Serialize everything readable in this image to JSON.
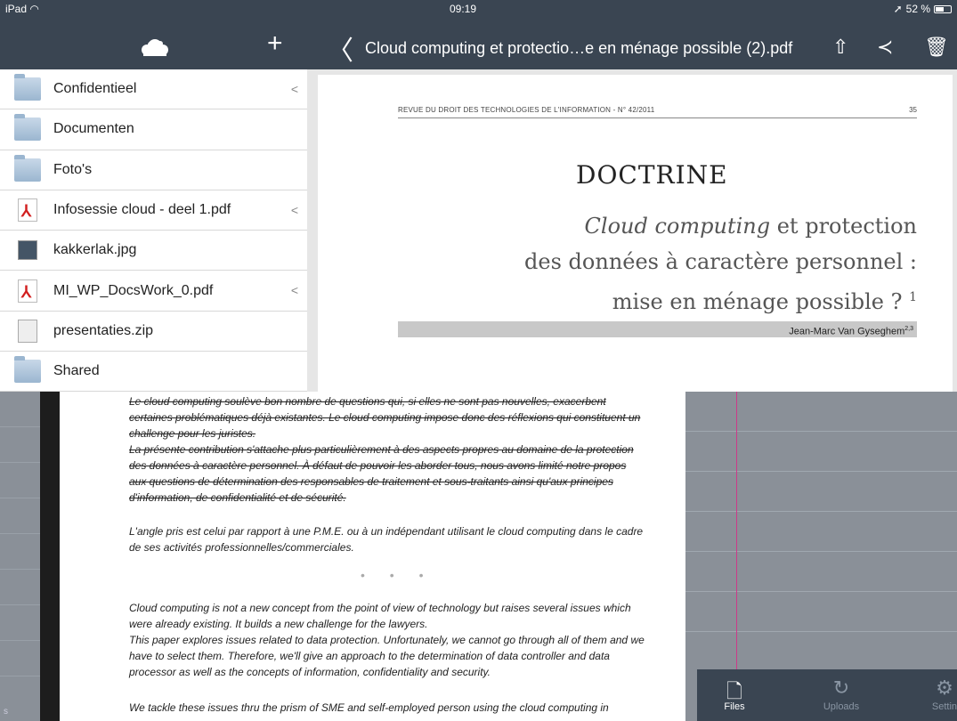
{
  "status": {
    "carrier": "iPad",
    "time": "09:19",
    "battery": "52 %"
  },
  "sidebar": {
    "add_label": "+",
    "files": [
      {
        "name": "Confidentieel",
        "type": "folder",
        "shared": true
      },
      {
        "name": "Documenten",
        "type": "folder",
        "shared": false
      },
      {
        "name": "Foto's",
        "type": "folder",
        "shared": false
      },
      {
        "name": "Infosessie cloud - deel 1.pdf",
        "type": "pdf",
        "shared": true
      },
      {
        "name": "kakkerlak.jpg",
        "type": "image",
        "shared": false
      },
      {
        "name": "MI_WP_DocsWork_0.pdf",
        "type": "pdf",
        "shared": true
      },
      {
        "name": "presentaties.zip",
        "type": "zip",
        "shared": false
      },
      {
        "name": "Shared",
        "type": "folder",
        "shared": false
      }
    ]
  },
  "viewer": {
    "back": "〈",
    "title": "Cloud computing et protectio…e en ménage possible  (2).pdf",
    "journal": "REVUE DU DROIT DES TECHNOLOGIES DE L'INFORMATION - N° 42/2011",
    "page_number": "35",
    "section": "DOCTRINE",
    "title_line1_italic": "Cloud computing",
    "title_line1_rest": " et protection",
    "title_line2": "des données à caractère personnel :",
    "title_line3": "mise en ménage possible ? ",
    "title_sup": "1",
    "author": "Jean-Marc Van Gyseghem",
    "author_sup": "2,3"
  },
  "text_page": {
    "p1": "Le cloud computing soulève bon nombre de questions qui, si elles ne sont pas nouvelles, exacerbent certaines problématiques déjà existantes. Le cloud computing impose donc des réflexions qui constituent un challenge pour les juristes.",
    "p2": "La présente contribution s'attache plus particulièrement à des aspects propres au domaine de la protection des données à caractère personnel. À défaut de pouvoir les aborder tous, nous avons limité notre propos aux questions de détermination des responsables de traitement et sous-traitants ainsi qu'aux principes d'information, de confidentialité et de sécurité.",
    "p3": "L'angle pris est celui par rapport à une P.M.E. ou à un indépendant utilisant le cloud computing dans le cadre de ses activités professionnelles/commerciales.",
    "dots": "• • •",
    "p4": "Cloud computing is not a new concept from the point of view of technology but raises several issues which were already existing. It builds a new challenge for the lawyers.",
    "p5": "This paper explores issues related to data protection. Unfortunately, we cannot go through all of them and we have to select them. Therefore, we'll give an approach to the determination of data controller and data processor as well as the concepts of information, confidentiality and security.",
    "p6": "We tackle these issues thru the prism of SME and self-employed person using the cloud computing in"
  },
  "tabs": [
    {
      "label": "Files",
      "icon": "files-icon"
    },
    {
      "label": "Uploads",
      "icon": "uploads-icon"
    },
    {
      "label": "Settin",
      "icon": "settings-icon"
    }
  ],
  "left_tab_fragment": "s"
}
